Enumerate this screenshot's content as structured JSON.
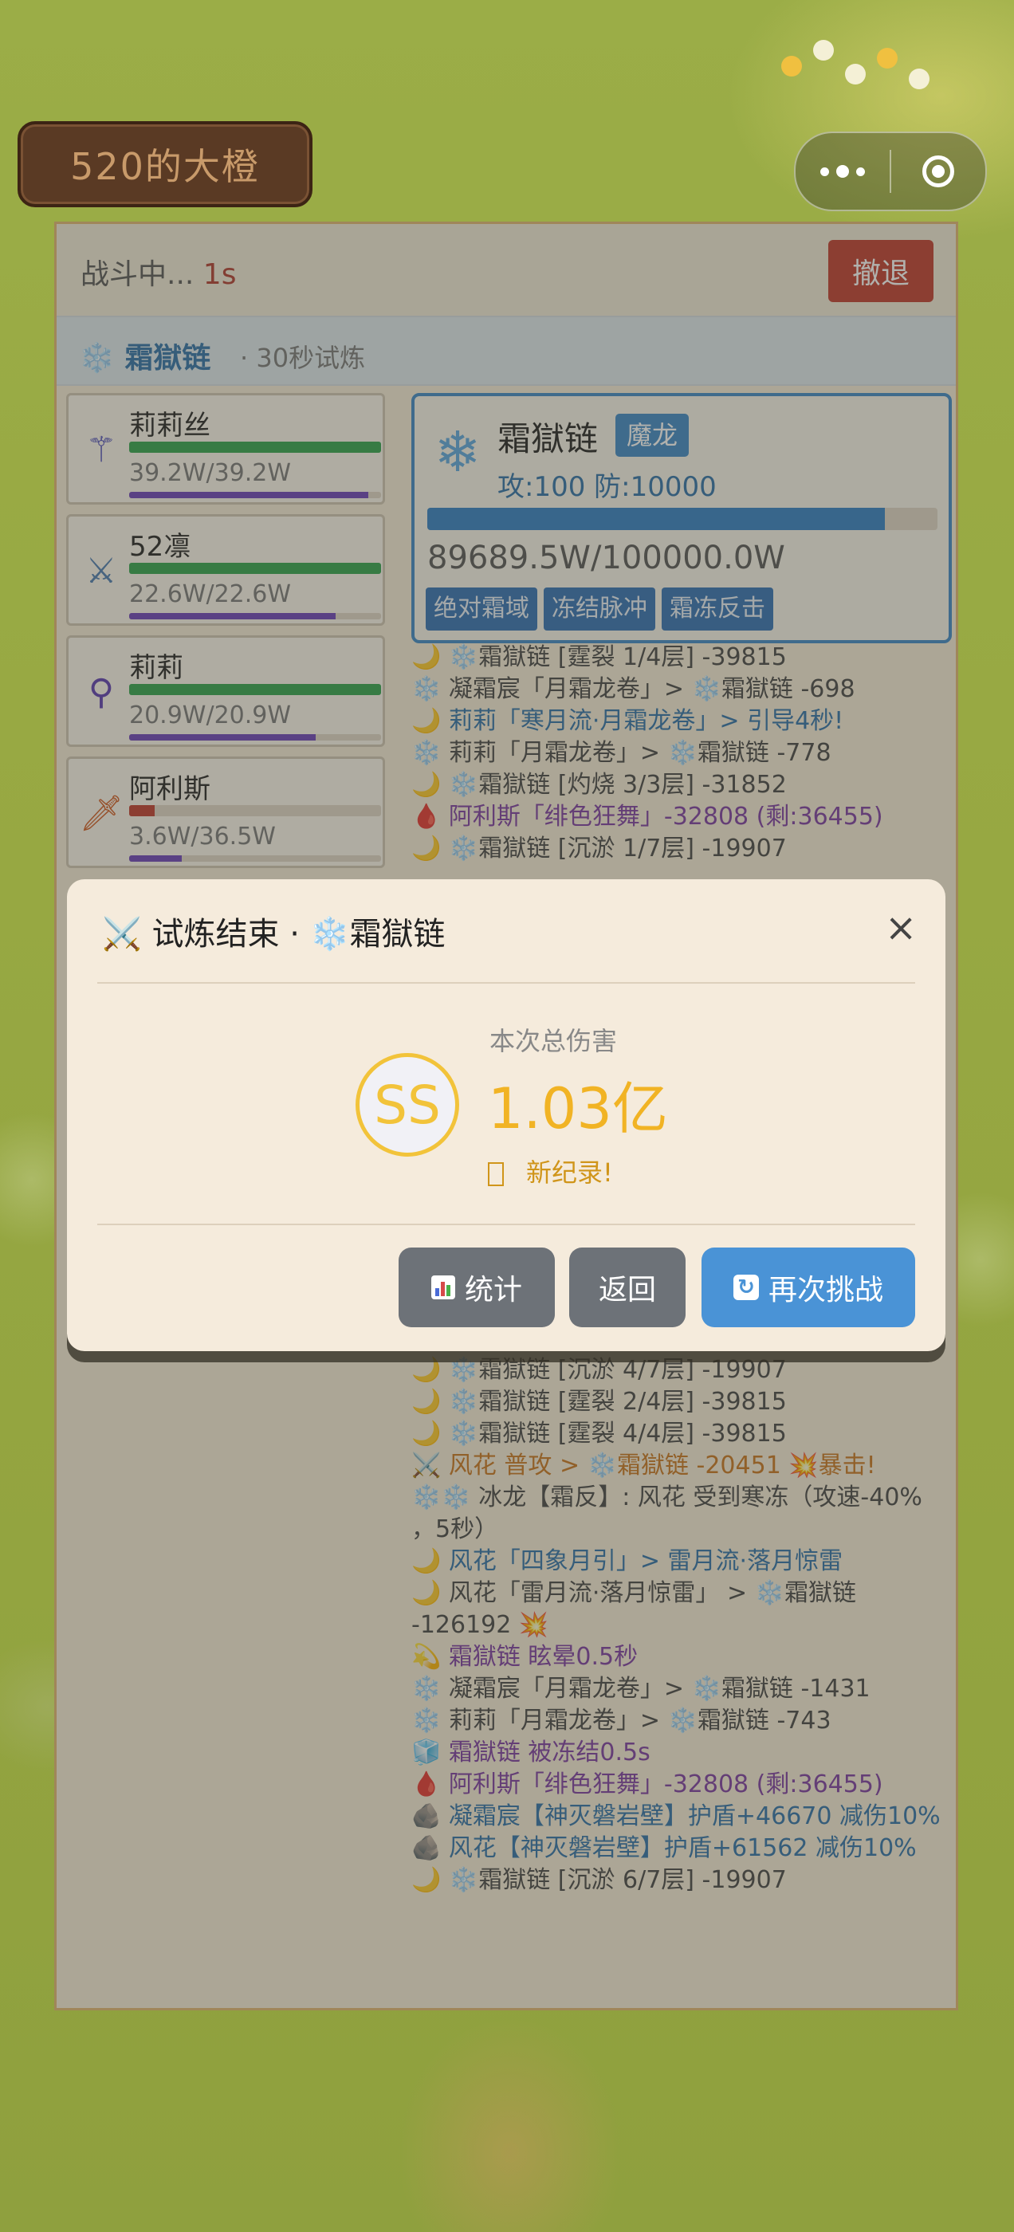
{
  "app": {
    "title": "520的大橙"
  },
  "status": {
    "prefix": "战斗中...",
    "time": "1s",
    "retreat_label": "撤退"
  },
  "boss_strip": {
    "name": "❄️ 霜獄链",
    "subtitle": "· 30秒试炼"
  },
  "heroes": [
    {
      "name": "莉莉丝",
      "hp_text": "39.2W/39.2W",
      "hp_fraction": 1.0,
      "mp_fraction": 0.95,
      "icon": "staff-icon"
    },
    {
      "name": "52凛",
      "hp_text": "22.6W/22.6W",
      "hp_fraction": 1.0,
      "mp_fraction": 0.82,
      "icon": "crossed-swords-icon"
    },
    {
      "name": "莉莉",
      "hp_text": "20.9W/20.9W",
      "hp_fraction": 1.0,
      "mp_fraction": 0.74,
      "icon": "orb-staff-icon"
    },
    {
      "name": "阿利斯",
      "hp_text": "3.6W/36.5W",
      "hp_fraction": 0.1,
      "mp_fraction": 0.21,
      "icon": "fire-blade-icon"
    }
  ],
  "boss": {
    "name": "霜獄链",
    "tag": "魔龙",
    "stats": "攻:100 防:10000",
    "hp_text": "89689.5W/100000.0W",
    "hp_fraction": 0.897,
    "skills": [
      "绝对霜域",
      "冻结脉冲",
      "霜冻反击"
    ],
    "icon": "snowflake-icon"
  },
  "log_top": [
    {
      "text": "🌙 ❄️霜獄链 [霆裂 1/4层] -39815",
      "cls": ""
    },
    {
      "text": "❄️ 凝霜宸「月霜龙卷」> ❄️霜獄链 -698",
      "cls": ""
    },
    {
      "text": "🌙 莉莉「寒月流·月霜龙卷」> 引导4秒!",
      "cls": "blue"
    },
    {
      "text": "❄️ 莉莉「月霜龙卷」> ❄️霜獄链 -778",
      "cls": ""
    },
    {
      "text": "🌙 ❄️霜獄链 [灼烧 3/3层] -31852",
      "cls": ""
    },
    {
      "text": "🩸 阿利斯「绯色狂舞」-32808 (剩:36455)",
      "cls": "purple"
    },
    {
      "text": "🌙 ❄️霜獄链 [沉淤 1/7层] -19907",
      "cls": ""
    }
  ],
  "log_bottom": [
    {
      "text": "🌙 ❄️霜獄链 [沉淤 4/7层] -19907",
      "cls": ""
    },
    {
      "text": "🌙 ❄️霜獄链 [霆裂 2/4层] -39815",
      "cls": ""
    },
    {
      "text": "🌙 ❄️霜獄链 [霆裂 4/4层] -39815",
      "cls": ""
    },
    {
      "text": "⚔️ 风花 普攻 > ❄️霜獄链 -20451 💥暴击!",
      "cls": "orange"
    },
    {
      "text": "❄️❄️ 冰龙【霜反】: 风花 受到寒冻（攻速-40%",
      "cls": ""
    },
    {
      "text": "，5秒）",
      "cls": ""
    },
    {
      "text": "🌙 风花「四象月引」> 雷月流·落月惊雷",
      "cls": "blue"
    },
    {
      "text": "🌙 风花「雷月流·落月惊雷」 > ❄️霜獄链",
      "cls": ""
    },
    {
      "text": "-126192 💥",
      "cls": ""
    },
    {
      "text": "  💫 霜獄链 眩晕0.5秒",
      "cls": "purple"
    },
    {
      "text": "❄️ 凝霜宸「月霜龙卷」> ❄️霜獄链 -1431",
      "cls": ""
    },
    {
      "text": "❄️ 莉莉「月霜龙卷」> ❄️霜獄链 -743",
      "cls": ""
    },
    {
      "text": "  🧊 霜獄链 被冻结0.5s",
      "cls": "purple"
    },
    {
      "text": "🩸 阿利斯「绯色狂舞」-32808 (剩:36455)",
      "cls": "purple"
    },
    {
      "text": "🪨 凝霜宸【神灭磐岩壁】护盾+46670 减伤10%",
      "cls": "blue"
    },
    {
      "text": "🪨 风花【神灭磐岩壁】护盾+61562 减伤10%",
      "cls": "blue"
    },
    {
      "text": "🌙 ❄️霜獄链 [沉淤 6/7层] -19907",
      "cls": ""
    }
  ],
  "modal": {
    "title": "⚔️ 试炼结束 · ❄️霜獄链",
    "close_label": "×",
    "damage_label": "本次总伤害",
    "grade": "SS",
    "damage": "1.03亿",
    "record": "新纪录!",
    "buttons": {
      "stats": "统计",
      "back": "返回",
      "again": "再次挑战"
    }
  },
  "colors": {
    "accent_blue": "#4a93d6",
    "gold": "#f1b324",
    "danger": "#c0392b",
    "panel_bg": "#f7ecd8"
  }
}
